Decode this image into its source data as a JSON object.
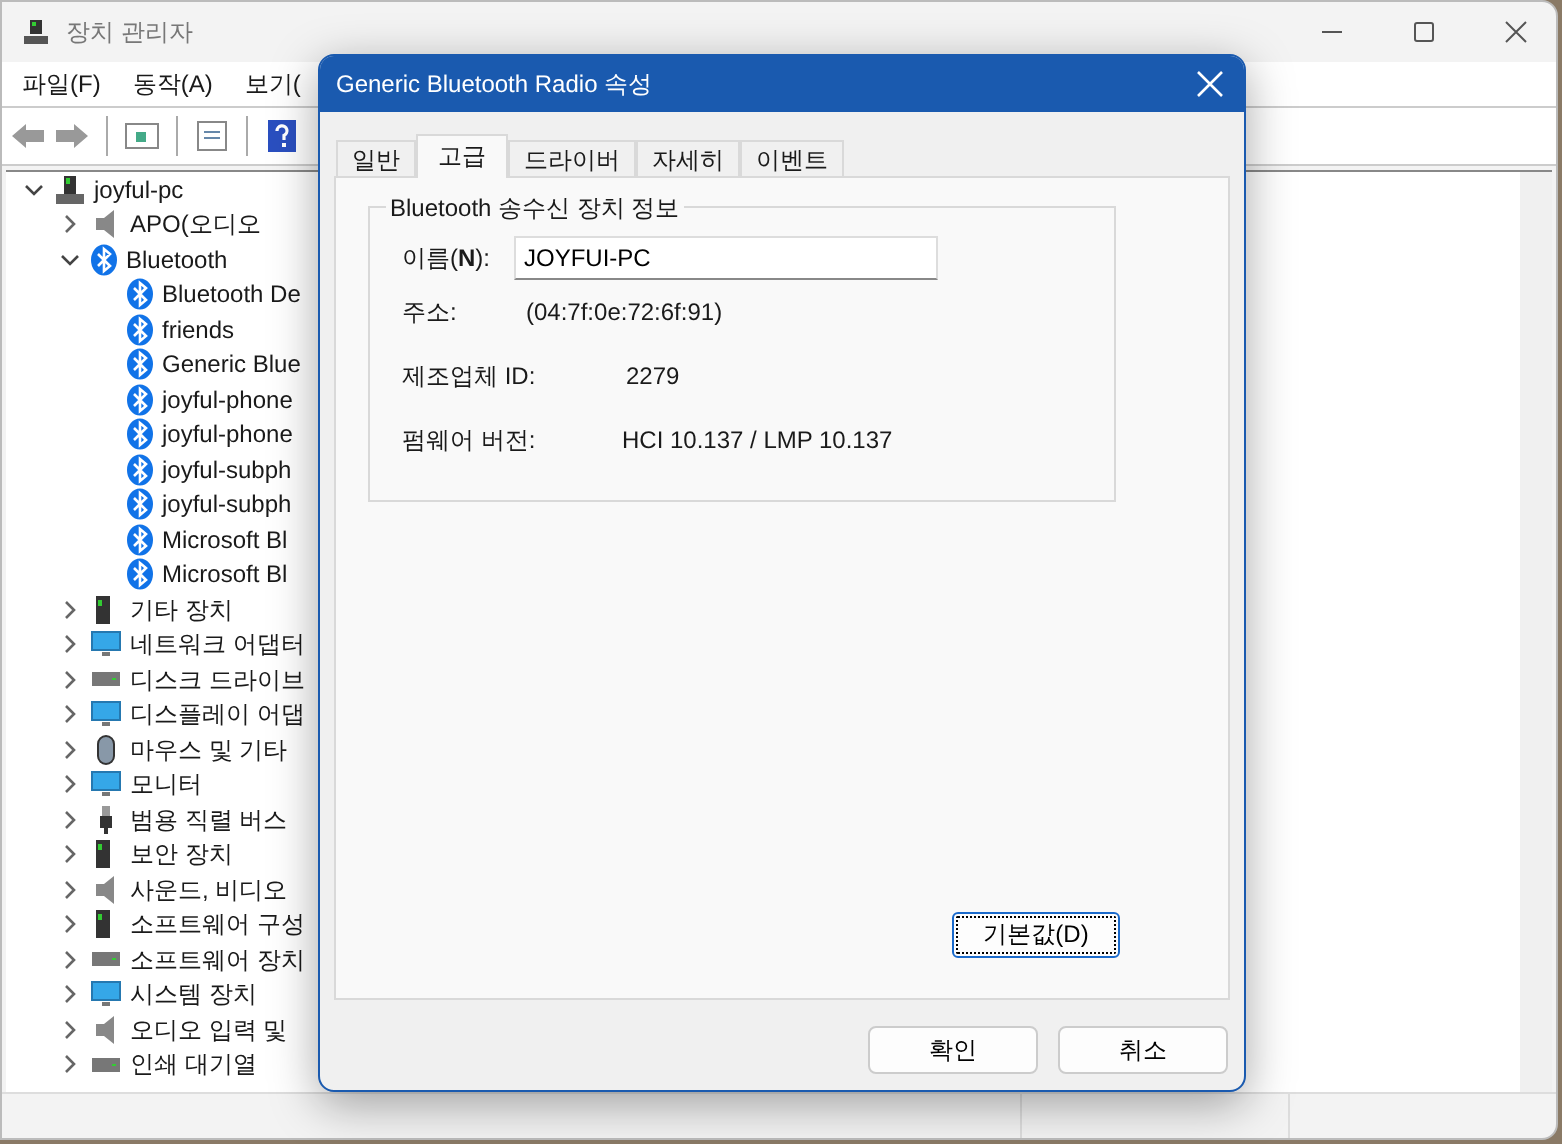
{
  "window": {
    "title": "장치 관리자"
  },
  "menu": [
    "파일(F)",
    "동작(A)",
    "보기("
  ],
  "tree": [
    {
      "label": "joyful-pc",
      "kind": "computer",
      "expanded": true,
      "children": [
        {
          "label": "APO(오디오",
          "kind": "speaker",
          "expanded": false
        },
        {
          "label": "Bluetooth",
          "kind": "bluetooth",
          "expanded": true,
          "children": [
            {
              "label": "Bluetooth De",
              "kind": "bluetooth"
            },
            {
              "label": "friends",
              "kind": "bluetooth"
            },
            {
              "label": "Generic Blue",
              "kind": "bluetooth"
            },
            {
              "label": "joyful-phone",
              "kind": "bluetooth"
            },
            {
              "label": "joyful-phone",
              "kind": "bluetooth"
            },
            {
              "label": "joyful-subph",
              "kind": "bluetooth"
            },
            {
              "label": "joyful-subph",
              "kind": "bluetooth"
            },
            {
              "label": "Microsoft Bl",
              "kind": "bluetooth"
            },
            {
              "label": "Microsoft Bl",
              "kind": "bluetooth"
            }
          ]
        },
        {
          "label": "기타 장치",
          "kind": "device",
          "expanded": false
        },
        {
          "label": "네트워크 어댑터",
          "kind": "monitor",
          "expanded": false
        },
        {
          "label": "디스크 드라이브",
          "kind": "disk",
          "expanded": false
        },
        {
          "label": "디스플레이 어댑",
          "kind": "monitor",
          "expanded": false
        },
        {
          "label": "마우스 및 기타",
          "kind": "mouse",
          "expanded": false
        },
        {
          "label": "모니터",
          "kind": "monitor",
          "expanded": false
        },
        {
          "label": "범용 직렬 버스",
          "kind": "usb",
          "expanded": false
        },
        {
          "label": "보안 장치",
          "kind": "device",
          "expanded": false
        },
        {
          "label": "사운드, 비디오",
          "kind": "speaker",
          "expanded": false
        },
        {
          "label": "소프트웨어 구성",
          "kind": "device",
          "expanded": false
        },
        {
          "label": "소프트웨어 장치",
          "kind": "disk",
          "expanded": false
        },
        {
          "label": "시스템 장치",
          "kind": "monitor",
          "expanded": false
        },
        {
          "label": "오디오 입력 및",
          "kind": "speaker",
          "expanded": false
        },
        {
          "label": "인쇄 대기열",
          "kind": "disk",
          "expanded": false
        }
      ]
    }
  ],
  "dialog": {
    "title": "Generic Bluetooth Radio 속성",
    "tabs": [
      {
        "label": "일반",
        "selected": false
      },
      {
        "label": "고급",
        "selected": true
      },
      {
        "label": "드라이버",
        "selected": false
      },
      {
        "label": "자세히",
        "selected": false
      },
      {
        "label": "이벤트",
        "selected": false
      }
    ],
    "group_title": "Bluetooth 송수신 장치 정보",
    "name_label": "이름(**N**):",
    "name_value": "JOYFUI-PC",
    "fields": [
      {
        "label": "주소:",
        "value": "(04:7f:0e:72:6f:91)"
      },
      {
        "label": "제조업체 ID:",
        "value": "2279"
      },
      {
        "label": "펌웨어 버전:",
        "value": "HCI 10.137  /  LMP 10.137"
      }
    ],
    "default_button": "기본값(D)",
    "buttons": [
      "확인",
      "취소"
    ]
  }
}
